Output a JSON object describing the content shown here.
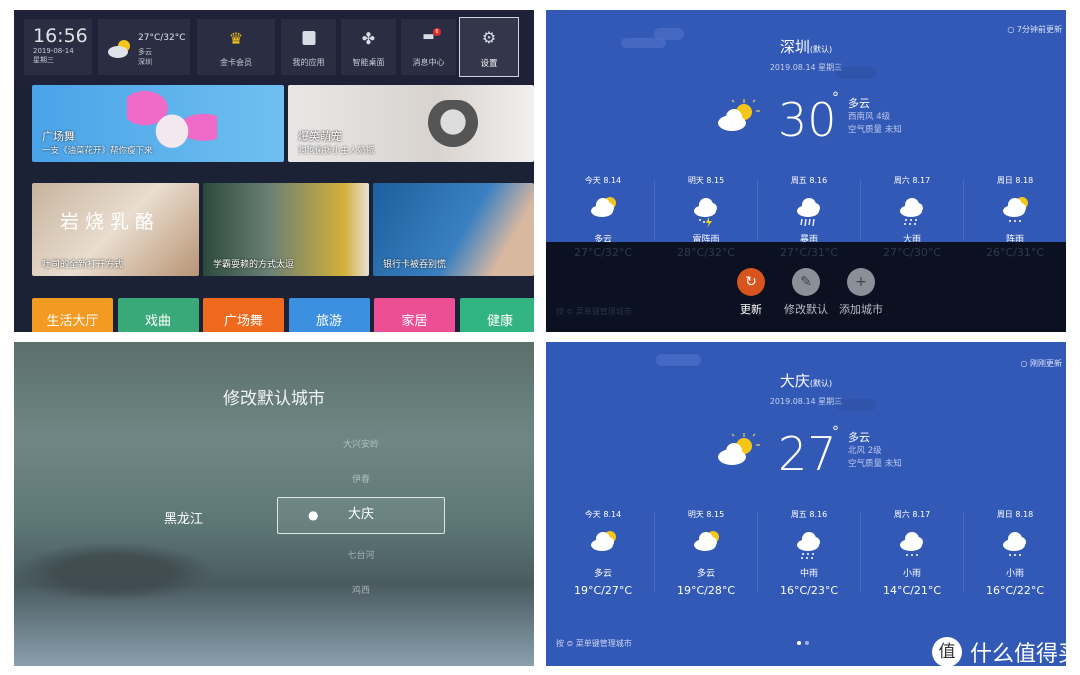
{
  "home": {
    "clock": {
      "time": "16:56",
      "date": "2019-08-14",
      "weekday": "星期三"
    },
    "weather": {
      "temp_range": "27°C/32°C",
      "condition": "多云",
      "city": "深圳"
    },
    "tiles": [
      {
        "label": "金卡会员",
        "icon": "crown-icon"
      },
      {
        "label": "我的应用",
        "icon": "shopping-bag-icon"
      },
      {
        "label": "智能桌面",
        "icon": "grid-icon"
      },
      {
        "label": "消息中心",
        "icon": "message-icon",
        "badge": "6"
      },
      {
        "label": "设置",
        "icon": "gear-icon",
        "selected": true
      }
    ],
    "banners_row1": [
      {
        "title": "广场舞",
        "subtitle": "一支《油菜花开》帮你瘦下来"
      },
      {
        "title": "爆笑萌宠",
        "subtitle": "狗狗偷拨小主人奶瓶"
      }
    ],
    "banners_row2": [
      {
        "title": "吐司的全新打开方式",
        "overlay_art": "岩烧乳酪"
      },
      {
        "title": "学霸耍赖的方式太逗"
      },
      {
        "title": "银行卡被吞别慌"
      }
    ],
    "categories": [
      {
        "label": "生活大厅",
        "color": "#f39a23"
      },
      {
        "label": "戏曲",
        "color": "#3aa97a"
      },
      {
        "label": "广场舞",
        "color": "#ef6a1e"
      },
      {
        "label": "旅游",
        "color": "#3d8fe0"
      },
      {
        "label": "家居",
        "color": "#ec4f93"
      },
      {
        "label": "健康",
        "color": "#31b47f"
      }
    ]
  },
  "weather_shenzhen": {
    "updated": "7分钟前更新",
    "city": "深圳",
    "default_tag": "(默认)",
    "date": "2019.08.14  星期三",
    "temp": "30",
    "degree": "°",
    "condition": "多云",
    "wind": "西南风 4级",
    "air": "空气质量 未知",
    "forecast": [
      {
        "day": "今天 8.14",
        "cond": "多云",
        "temp": "27°C/32°C",
        "icon": "partly-cloudy"
      },
      {
        "day": "明天 8.15",
        "cond": "雷阵雨",
        "temp": "28°C/32°C",
        "icon": "thunderstorm"
      },
      {
        "day": "周五 8.16",
        "cond": "暴雨",
        "temp": "27°C/31°C",
        "icon": "heavy-rain"
      },
      {
        "day": "周六 8.17",
        "cond": "大雨",
        "temp": "27°C/30°C",
        "icon": "rain"
      },
      {
        "day": "周日 8.18",
        "cond": "阵雨",
        "temp": "26°C/31°C",
        "icon": "shower"
      }
    ],
    "actions": [
      {
        "label": "更新",
        "icon": "refresh-icon",
        "active": true
      },
      {
        "label": "修改默认",
        "icon": "pencil-icon"
      },
      {
        "label": "添加城市",
        "icon": "plus-icon"
      }
    ],
    "hint": "按 ⊜ 菜单键管理城市"
  },
  "city_picker": {
    "title": "修改默认城市",
    "province": "黑龙江",
    "options_above": [
      "大兴安岭",
      "伊春"
    ],
    "selected": "大庆",
    "options_below": [
      "七台河",
      "鸡西"
    ]
  },
  "weather_daqing": {
    "updated": "刚刚更新",
    "city": "大庆",
    "default_tag": "(默认)",
    "date": "2019.08.14  星期三",
    "temp": "27",
    "degree": "°",
    "condition": "多云",
    "wind": "北风 2级",
    "air": "空气质量 未知",
    "forecast": [
      {
        "day": "今天 8.14",
        "cond": "多云",
        "temp": "19°C/27°C",
        "icon": "partly-cloudy"
      },
      {
        "day": "明天 8.15",
        "cond": "多云",
        "temp": "19°C/28°C",
        "icon": "partly-cloudy"
      },
      {
        "day": "周五 8.16",
        "cond": "中雨",
        "temp": "16°C/23°C",
        "icon": "rain"
      },
      {
        "day": "周六 8.17",
        "cond": "小雨",
        "temp": "14°C/21°C",
        "icon": "light-rain"
      },
      {
        "day": "周日 8.18",
        "cond": "小雨",
        "temp": "16°C/22°C",
        "icon": "light-rain"
      }
    ],
    "hint": "按 ⊜ 菜单键管理城市",
    "page_dots": 2,
    "page_active": 1
  },
  "watermark": {
    "logo": "值",
    "text": "什么值得买"
  }
}
